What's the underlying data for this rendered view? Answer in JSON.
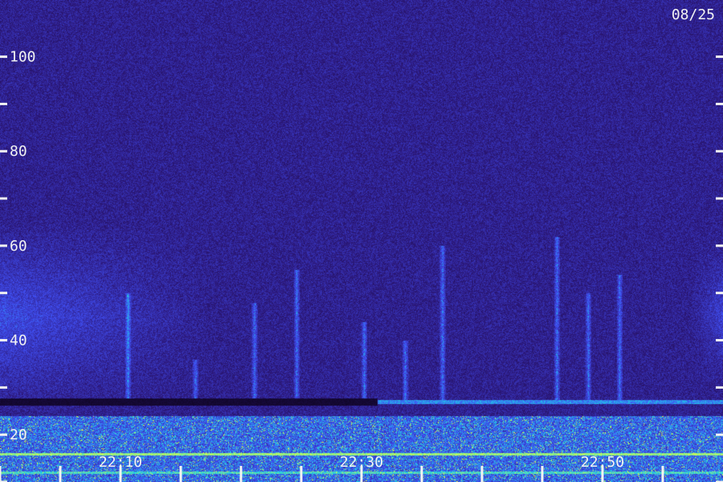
{
  "date_label": "08/25",
  "colors": {
    "background": "#1b0b4a",
    "noise_low": "#2a1470",
    "noise_mid": "#3b2ad0",
    "signal_blue": "#2f7cff",
    "signal_cyan": "#42e6e0",
    "signal_green": "#b7ff5a",
    "tick": "#f2f2f2",
    "text": "#f2f2f2",
    "dark_band": "#0a0418"
  },
  "chart_data": {
    "type": "heatmap",
    "title": "",
    "xlabel": "",
    "ylabel": "",
    "x_range_minutes": [
      0,
      60
    ],
    "x_start_time": "22:00",
    "y_range": [
      10,
      112
    ],
    "x_ticks": [
      {
        "value": 10,
        "label": "22:10"
      },
      {
        "value": 30,
        "label": "22:30"
      },
      {
        "value": 50,
        "label": "22:50"
      }
    ],
    "x_minor_ticks_minutes": [
      0,
      5,
      10,
      15,
      20,
      25,
      30,
      35,
      40,
      45,
      50,
      55
    ],
    "y_ticks": [
      {
        "value": 20,
        "label": "20"
      },
      {
        "value": 40,
        "label": "40"
      },
      {
        "value": 60,
        "label": "60"
      },
      {
        "value": 80,
        "label": "80"
      },
      {
        "value": 100,
        "label": "100"
      }
    ],
    "y_minor_ticks": [
      10,
      30,
      50,
      70,
      90
    ],
    "features": {
      "horizontal_band_y": 27,
      "bright_line_y": 12,
      "green_band_y": 16,
      "vertical_streaks": [
        {
          "x_minutes": 10.6,
          "y_top": 50
        },
        {
          "x_minutes": 16.2,
          "y_top": 36
        },
        {
          "x_minutes": 21.1,
          "y_top": 48
        },
        {
          "x_minutes": 24.6,
          "y_top": 55
        },
        {
          "x_minutes": 30.2,
          "y_top": 44
        },
        {
          "x_minutes": 33.6,
          "y_top": 40
        },
        {
          "x_minutes": 36.7,
          "y_top": 60
        },
        {
          "x_minutes": 46.2,
          "y_top": 62
        },
        {
          "x_minutes": 48.8,
          "y_top": 50
        },
        {
          "x_minutes": 51.4,
          "y_top": 54
        }
      ]
    }
  }
}
